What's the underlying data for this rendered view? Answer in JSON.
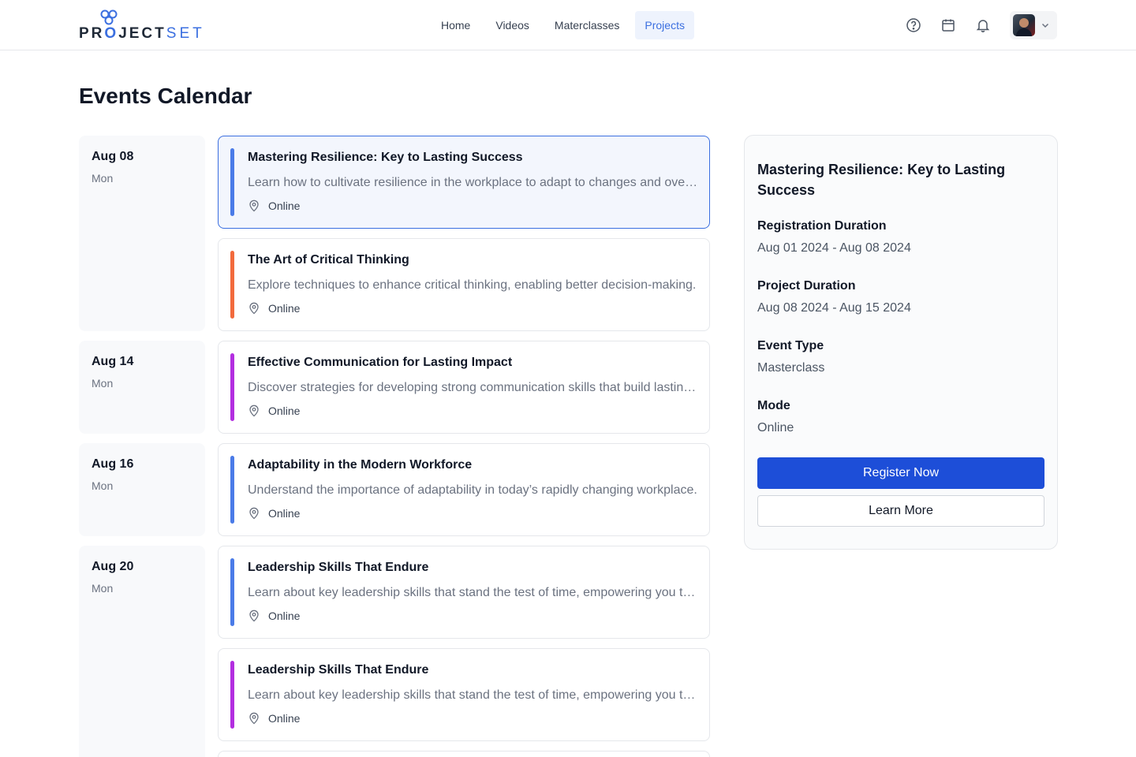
{
  "brand": {
    "part1": "PR",
    "o": "O",
    "part2": "JECT",
    "part3": "SET",
    "accent": "#3b6fe0"
  },
  "nav": [
    {
      "label": "Home",
      "active": false
    },
    {
      "label": "Videos",
      "active": false
    },
    {
      "label": "Materclasses",
      "active": false
    },
    {
      "label": "Projects",
      "active": true
    }
  ],
  "header_icons": [
    "help-circle-icon",
    "calendar-icon",
    "bell-icon",
    "chevron-down-icon"
  ],
  "page_title": "Events Calendar",
  "dates": [
    {
      "date": "Aug 08",
      "day": "Mon"
    },
    {
      "date": "Aug 14",
      "day": "Mon"
    },
    {
      "date": "Aug 16",
      "day": "Mon"
    },
    {
      "date": "Aug 20",
      "day": "Mon"
    }
  ],
  "events": [
    {
      "title": "Mastering Resilience: Key to Lasting Success",
      "desc": "Learn how to cultivate resilience in the workplace to adapt to changes and overcome challenges.",
      "location": "Online",
      "color": "#4a7be8",
      "selected": true
    },
    {
      "title": "The Art of Critical Thinking",
      "desc": "Explore techniques to enhance critical thinking, enabling better decision-making.",
      "location": "Online",
      "color": "#f26a3d",
      "selected": false
    },
    {
      "title": "Effective Communication for Lasting Impact",
      "desc": "Discover strategies for developing strong communication skills that build lasting relationships.",
      "location": "Online",
      "color": "#b32ee0",
      "selected": false
    },
    {
      "title": "Adaptability in the Modern Workforce",
      "desc": "Understand the importance of adaptability in today’s rapidly changing workplace.",
      "location": "Online",
      "color": "#4a7be8",
      "selected": false
    },
    {
      "title": "Leadership Skills That Endure",
      "desc": "Learn about key leadership skills that stand the test of time, empowering you to lead.",
      "location": "Online",
      "color": "#4a7be8",
      "selected": false
    },
    {
      "title": "Leadership Skills That Endure",
      "desc": "Learn about key leadership skills that stand the test of time, empowering you to lead.",
      "location": "Online",
      "color": "#b32ee0",
      "selected": false
    }
  ],
  "detail": {
    "title": "Mastering Resilience: Key to Lasting Success",
    "registration_label": "Registration Duration",
    "registration_value": "Aug 01 2024 - Aug 08 2024",
    "project_label": "Project Duration",
    "project_value": "Aug 08 2024 - Aug 15 2024",
    "type_label": "Event Type",
    "type_value": "Masterclass",
    "mode_label": "Mode",
    "mode_value": "Online",
    "register_label": "Register Now",
    "learn_label": "Learn More"
  }
}
